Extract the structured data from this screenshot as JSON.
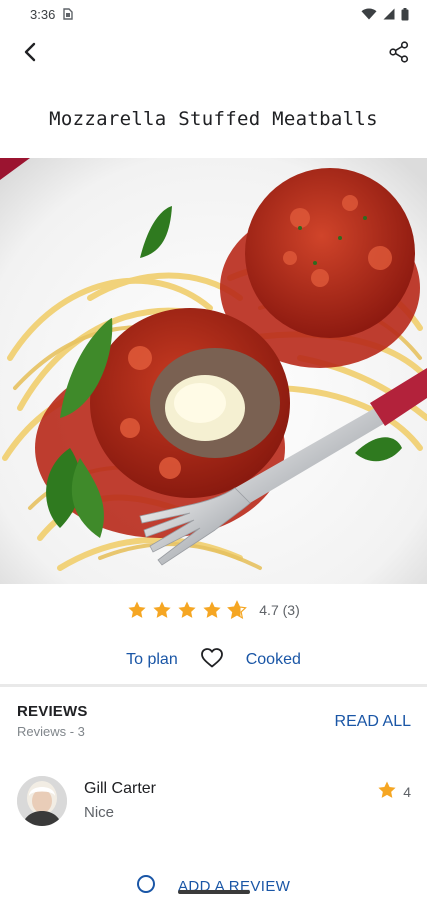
{
  "status_bar": {
    "time": "3:36",
    "icons": [
      "sim-icon",
      "wifi-icon",
      "signal-icon",
      "battery-icon"
    ]
  },
  "app_bar": {
    "back_icon": "arrow-back-icon",
    "share_icon": "share-icon"
  },
  "recipe": {
    "title": "Mozzarella Stuffed Meatballs",
    "rating": {
      "value": 4.7,
      "stars_max": 5,
      "text": "4.7 (3)"
    }
  },
  "actions": {
    "to_plan_label": "To plan",
    "favorite_icon": "heart-outline-icon",
    "cooked_label": "Cooked"
  },
  "reviews": {
    "title": "REVIEWS",
    "count_text": "Reviews - 3",
    "read_all_label": "READ ALL",
    "items": [
      {
        "name": "Gill Carter",
        "text": "Nice",
        "rating": "4"
      }
    ],
    "add_review_label": "ADD A REVIEW"
  },
  "colors": {
    "accent_blue": "#1a56a6",
    "star_orange": "#f5a623",
    "divider": "#e9e9e9"
  }
}
